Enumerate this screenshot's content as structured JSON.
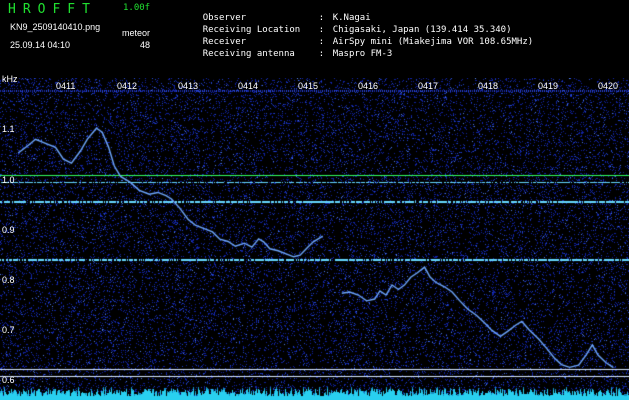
{
  "header": {
    "app_name": "HROFFT",
    "version": "1.00f",
    "filename": "KN9_2509140410.png",
    "mode": "meteor",
    "timestamp": "25.09.14 04:10",
    "count": "48"
  },
  "meta": [
    {
      "key": "Observer",
      "value": "K.Nagai"
    },
    {
      "key": "Receiving Location",
      "value": "Chigasaki, Japan (139.414 35.340)"
    },
    {
      "key": "Receiver",
      "value": "AirSpy mini (Miakejima VOR 108.65MHz)"
    },
    {
      "key": "Receiving antenna",
      "value": "Maspro FM-3"
    }
  ],
  "separator": ":",
  "axis": {
    "unit": "kHz",
    "yticks": [
      "1.1",
      "1.0",
      "0.9",
      "0.8",
      "0.7",
      "0.6"
    ],
    "time_labels": [
      "0411",
      "0412",
      "0413",
      "0414",
      "0415",
      "0416",
      "0417",
      "0418",
      "0419",
      "0420"
    ]
  },
  "colors": {
    "background": "#000000",
    "noise": "#1a2fc8",
    "signal": "#6fa8ff",
    "carrier": "#66d8ff",
    "green_line": "#30ff60",
    "floor": "#29d0f0"
  }
}
